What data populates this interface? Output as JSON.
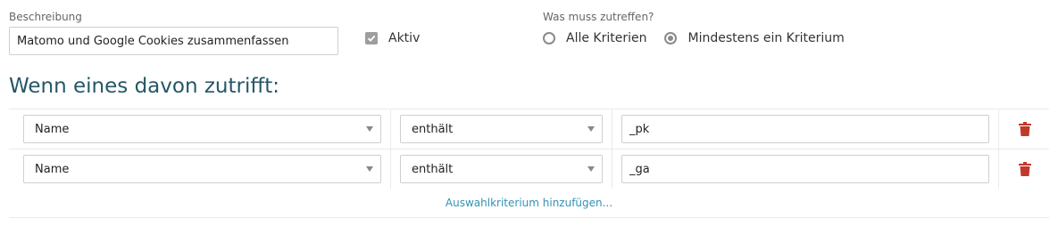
{
  "form": {
    "description_label": "Beschreibung",
    "description_value": "Matomo und Google Cookies zusammenfassen",
    "active_label": "Aktiv",
    "active_checked": true,
    "match_label": "Was muss zutreffen?",
    "match_options": [
      "Alle Kriterien",
      "Mindestens ein Kriterium"
    ],
    "match_selected": "Mindestens ein Kriterium"
  },
  "heading": "Wenn eines davon zutrifft:",
  "rules": [
    {
      "field": "Name",
      "operator": "enthält",
      "value": "_pk"
    },
    {
      "field": "Name",
      "operator": "enthält",
      "value": "_ga"
    }
  ],
  "add_link": "Auswahlkriterium hinzufügen...",
  "icons": {
    "delete": "trash-icon",
    "dropdown": "caret-down-icon",
    "checkbox": "check-icon"
  },
  "colors": {
    "heading": "#255766",
    "link": "#3192b5",
    "trash": "#c0392b",
    "checkbox": "#9e9e9e"
  }
}
